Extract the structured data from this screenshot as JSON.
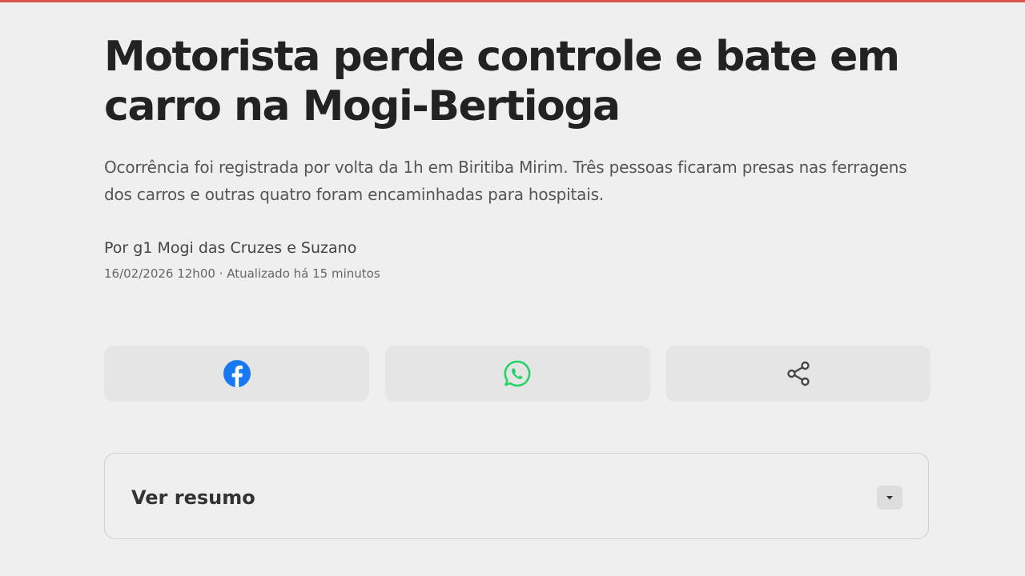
{
  "article": {
    "headline": "Motorista perde controle e bate em carro na Mogi-Bertioga",
    "subheadline": "Ocorrência foi registrada por volta da 1h em Biritiba Mirim. Três pessoas ficaram presas nas ferragens dos carros e outras quatro foram encaminhadas para hospitais.",
    "byline": "Por g1 Mogi das Cruzes e Suzano",
    "dateline": "16/02/2026 12h00 · Atualizado há 15 minutos"
  },
  "share": {
    "buttons": [
      {
        "icon": "facebook-icon",
        "color": "#1877f2"
      },
      {
        "icon": "whatsapp-icon",
        "color": "#25d366"
      },
      {
        "icon": "share-icon",
        "color": "#444444"
      }
    ]
  },
  "summary": {
    "label": "Ver resumo",
    "toggle_icon": "caret-down-icon"
  },
  "colors": {
    "background": "#efefef",
    "accent_bar": "#d9534f",
    "button_bg": "#e5e5e5"
  }
}
